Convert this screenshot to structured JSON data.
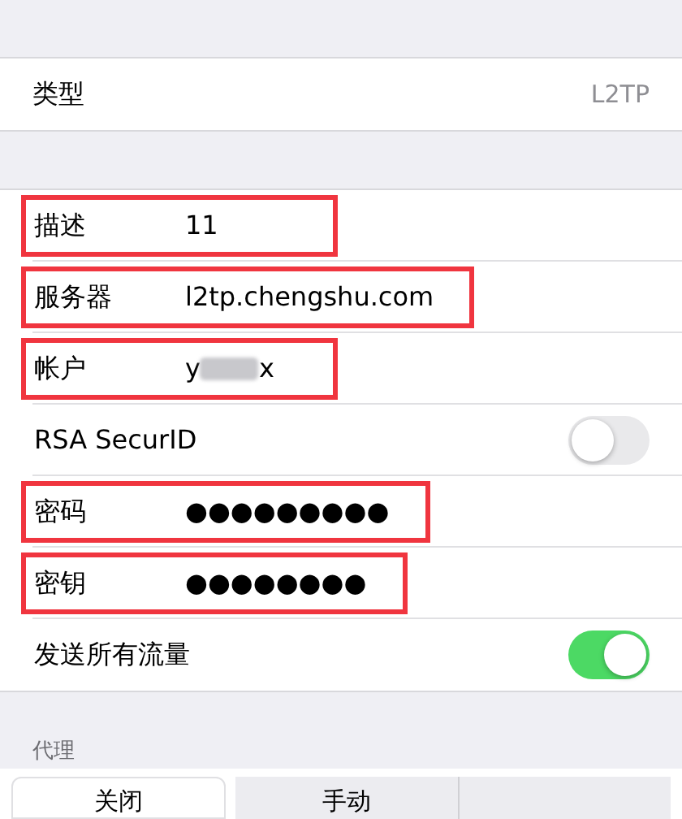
{
  "type_row": {
    "label": "类型",
    "value": "L2TP"
  },
  "fields": [
    {
      "kind": "text",
      "label": "描述",
      "value": "11",
      "highlighted": true
    },
    {
      "kind": "text",
      "label": "服务器",
      "value": "l2tp.chengshu.com",
      "highlighted": true
    },
    {
      "kind": "redacted",
      "label": "帐户",
      "value_start": "y",
      "value_end": "x",
      "highlighted": true
    },
    {
      "kind": "switch",
      "label": "RSA SecurID",
      "on": false,
      "highlighted": false
    },
    {
      "kind": "text",
      "label": "密码",
      "value": "●●●●●●●●●",
      "highlighted": true
    },
    {
      "kind": "text",
      "label": "密钥",
      "value": "●●●●●●●●",
      "highlighted": true
    },
    {
      "kind": "switch",
      "label": "发送所有流量",
      "on": true,
      "highlighted": false
    }
  ],
  "proxy": {
    "header": "代理",
    "segments": [
      {
        "label": "关闭",
        "selected": true
      },
      {
        "label": "手动",
        "selected": false
      }
    ]
  }
}
